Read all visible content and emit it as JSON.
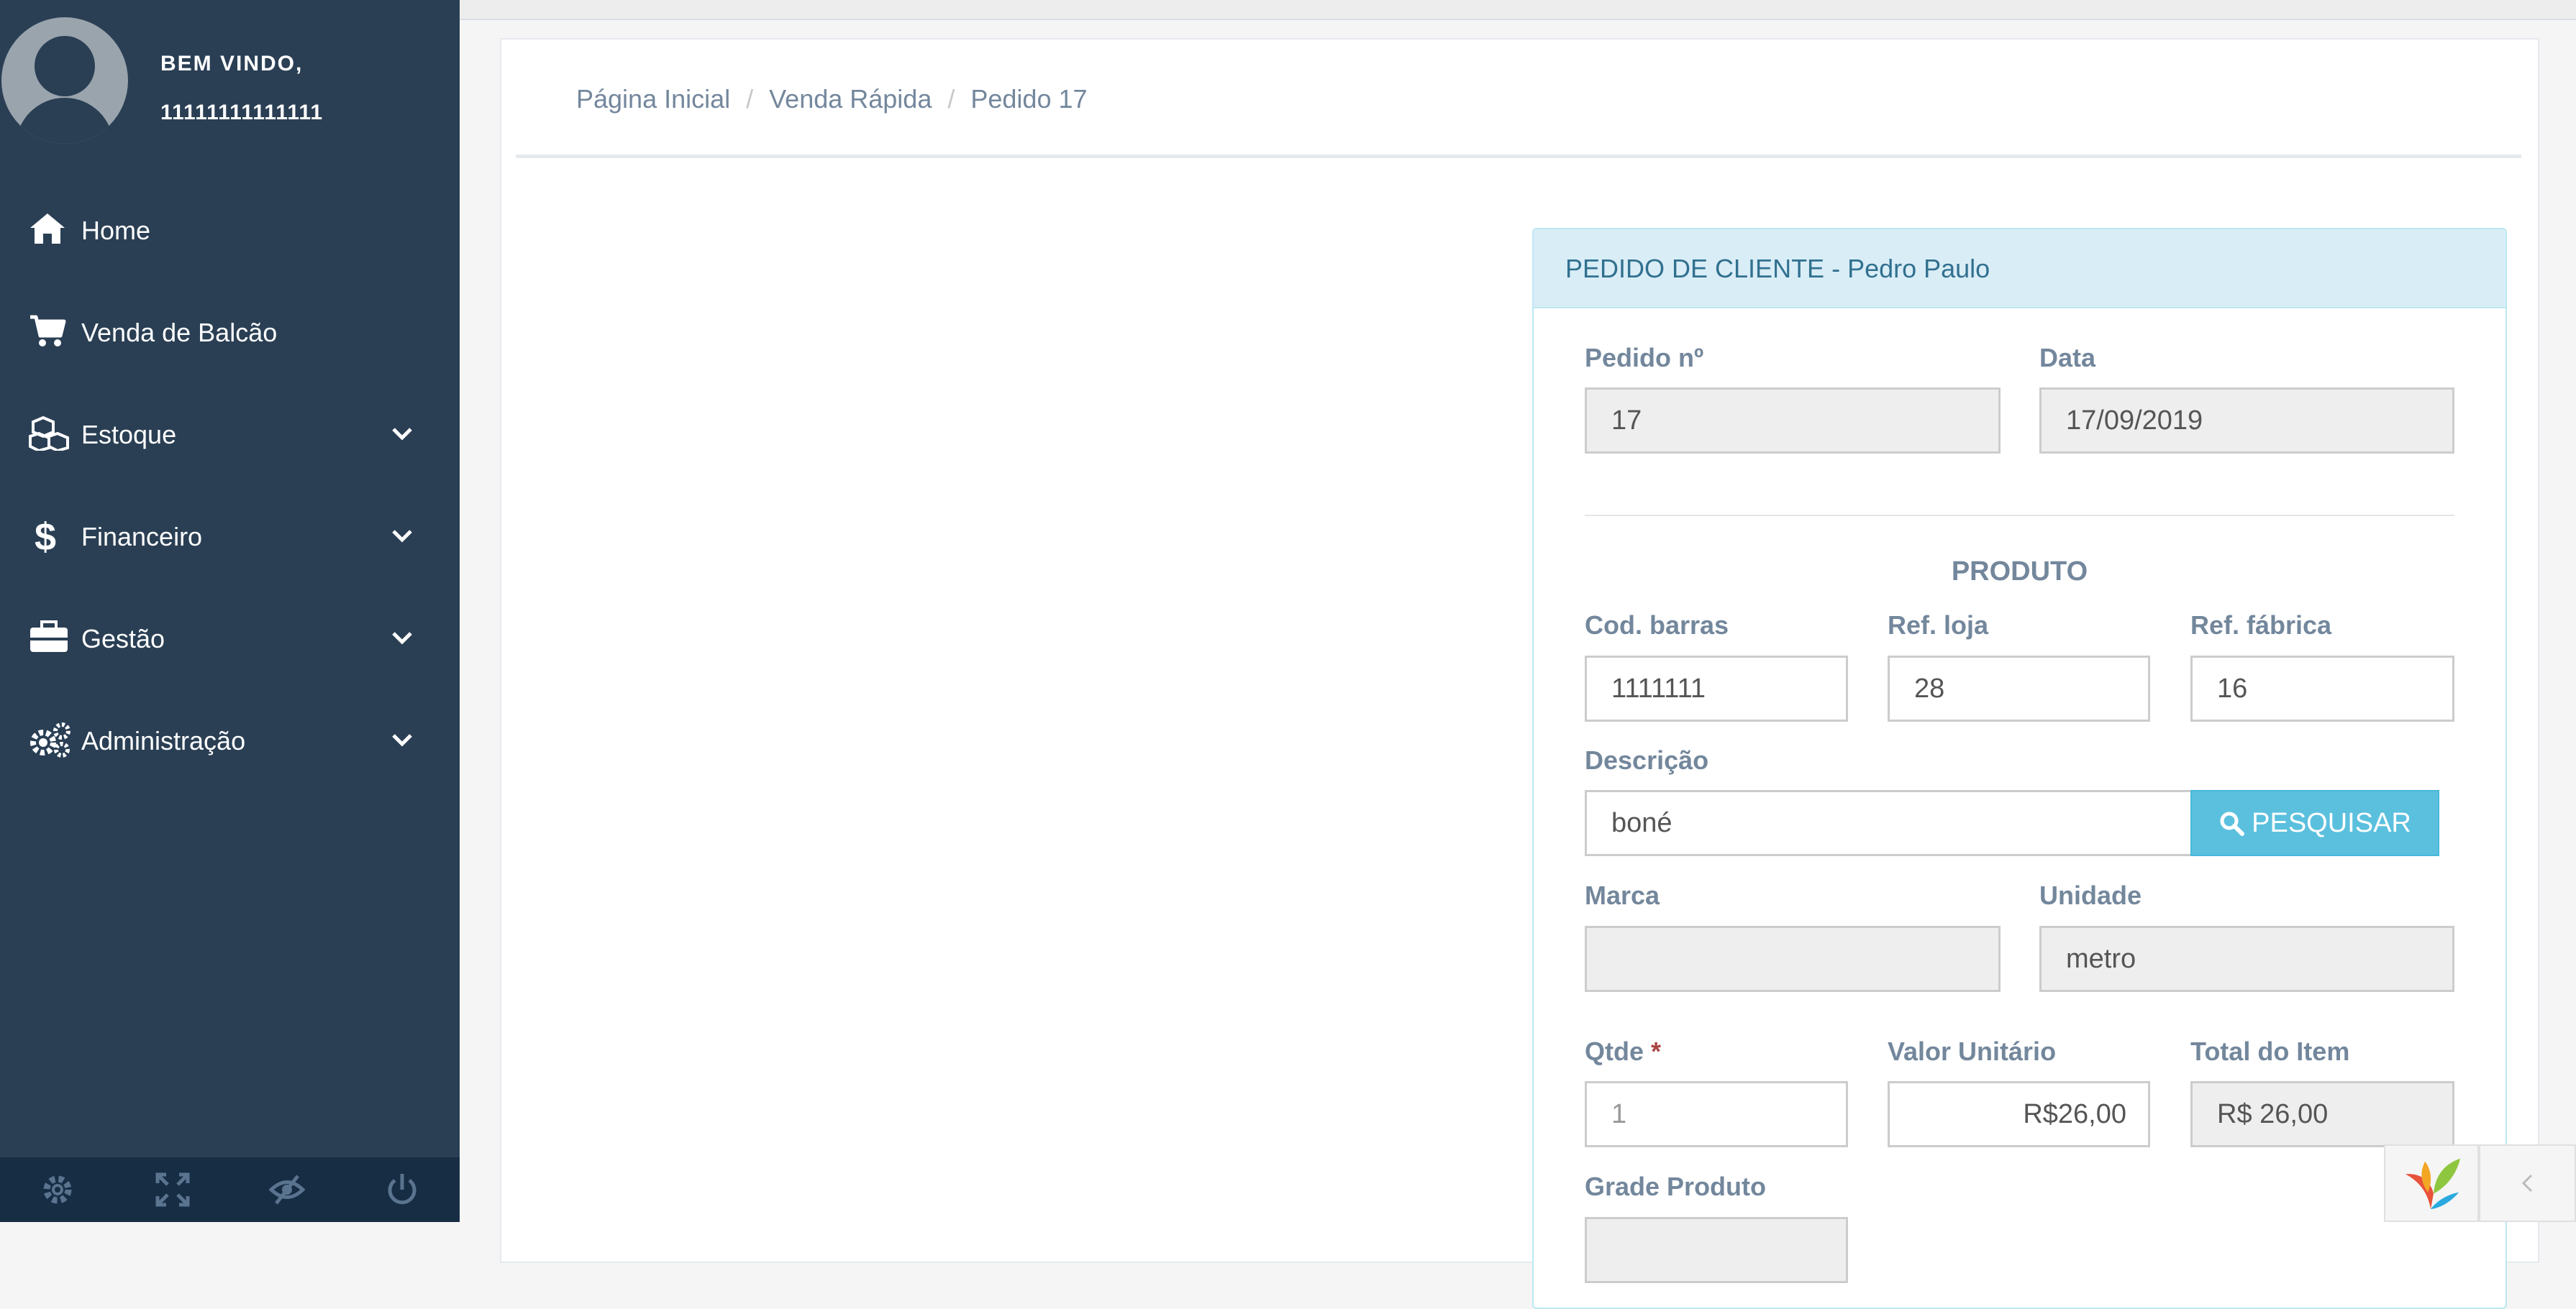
{
  "sidebar": {
    "welcome": "BEM VINDO,",
    "username": "11111111111111",
    "items": [
      {
        "label": "Home",
        "icon": "home-icon",
        "has_submenu": false
      },
      {
        "label": "Venda de Balcão",
        "icon": "cart-icon",
        "has_submenu": false
      },
      {
        "label": "Estoque",
        "icon": "cubes-icon",
        "has_submenu": true
      },
      {
        "label": "Financeiro",
        "icon": "dollar-icon",
        "has_submenu": true
      },
      {
        "label": "Gestão",
        "icon": "briefcase-icon",
        "has_submenu": true
      },
      {
        "label": "Administração",
        "icon": "gears-icon",
        "has_submenu": true
      }
    ],
    "footer_icons": [
      "gear-icon",
      "fullscreen-icon",
      "eye-slash-icon",
      "power-icon"
    ]
  },
  "breadcrumb": [
    "Página Inicial",
    "Venda Rápida",
    "Pedido 17"
  ],
  "card": {
    "title": "PEDIDO DE CLIENTE - Pedro Paulo",
    "pedido_label": "Pedido nº",
    "pedido_value": "17",
    "data_label": "Data",
    "data_value": "17/09/2019",
    "section_title": "PRODUTO",
    "cod_barras_label": "Cod. barras",
    "cod_barras_value": "1111111",
    "ref_loja_label": "Ref. loja",
    "ref_loja_value": "28",
    "ref_fabrica_label": "Ref. fábrica",
    "ref_fabrica_value": "16",
    "descricao_label": "Descrição",
    "descricao_value": "boné",
    "search_button": "PESQUISAR",
    "marca_label": "Marca",
    "marca_value": "",
    "unidade_label": "Unidade",
    "unidade_value": "metro",
    "qtde_label": "Qtde",
    "qtde_required": "*",
    "qtde_placeholder": "1",
    "valor_unitario_label": "Valor Unitário",
    "valor_unitario_value": "R$26,00",
    "total_item_label": "Total do Item",
    "total_item_value": "R$ 26,00",
    "grade_label": "Grade Produto",
    "grade_value": ""
  },
  "colors": {
    "sidebar_bg": "#2a3f54",
    "sidebar_footer_bg": "#172d44",
    "card_header_bg": "#d9edf7",
    "card_title": "#31708f",
    "label": "#73879c",
    "search_button_bg": "#5bc0de"
  }
}
